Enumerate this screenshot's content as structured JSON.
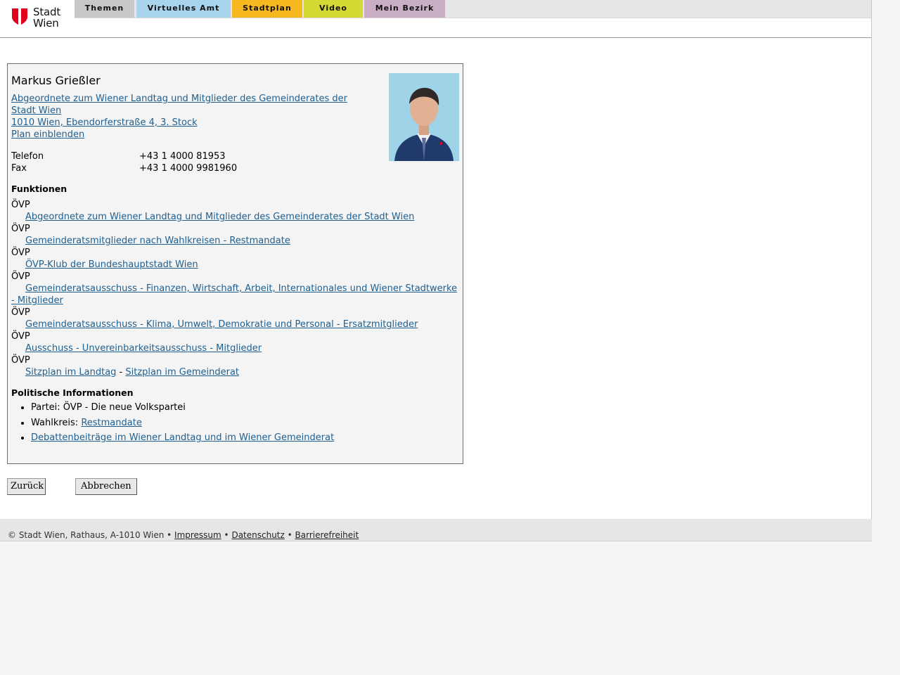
{
  "logo": {
    "line1": "Stadt",
    "line2": "Wien"
  },
  "nav": {
    "tabs": [
      {
        "label": "Themen",
        "color": "#c8c8c8"
      },
      {
        "label": "Virtuelles Amt",
        "color": "#a9d4ee"
      },
      {
        "label": "Stadtplan",
        "color": "#f6b71f"
      },
      {
        "label": "Video",
        "color": "#d6d834"
      },
      {
        "label": "Mein Bezirk",
        "color": "#c9aec5"
      }
    ]
  },
  "person": {
    "name": "Markus Grießler",
    "role_link": "Abgeordnete zum Wiener Landtag und Mitglieder des Gemeinderates der Stadt Wien ",
    "address_link": "1010 Wien, Ebendorferstraße 4, 3. Stock",
    "plan_link": "Plan einblenden",
    "contacts": [
      {
        "label": "Telefon",
        "value": "+43 1 4000 81953"
      },
      {
        "label": "Fax",
        "value": "+43 1 4000 9981960"
      }
    ]
  },
  "functions": {
    "heading": "Funktionen",
    "items": [
      {
        "party": "ÖVP",
        "link": "Abgeordnete zum Wiener Landtag und Mitglieder des Gemeinderates der Stadt Wien"
      },
      {
        "party": "ÖVP",
        "link": "Gemeinderatsmitglieder nach Wahlkreisen - Restmandate"
      },
      {
        "party": "ÖVP",
        "link": "ÖVP-Klub der Bundeshauptstadt Wien"
      },
      {
        "party": "ÖVP",
        "link": "Gemeinderatsausschuss - Finanzen, Wirtschaft, Arbeit, Internationales und Wiener Stadtwerke - Mitglieder"
      },
      {
        "party": "ÖVP",
        "link": "Gemeinderatsausschuss - Klima, Umwelt, Demokratie und Personal - Ersatzmitglieder"
      },
      {
        "party": "ÖVP",
        "link": "Ausschuss - Unvereinbarkeitsausschuss - Mitglieder"
      }
    ],
    "last_party": "ÖVP",
    "sitzplan_landtag": "Sitzplan im Landtag",
    "sitzplan_separator": " - ",
    "sitzplan_gemeinderat": "Sitzplan im Gemeinderat"
  },
  "political": {
    "heading": "Politische Informationen",
    "partei_label": "Partei: ",
    "partei_value": "ÖVP - Die neue Volkspartei",
    "wahlkreis_label": "Wahlkreis: ",
    "wahlkreis_link": "Restmandate",
    "debatten_link": "Debattenbeiträge im Wiener Landtag und im Wiener Gemeinderat"
  },
  "buttons": {
    "back": "Zurück",
    "cancel": "Abbrechen"
  },
  "footer": {
    "copyright": "© Stadt Wien, Rathaus, A-1010 Wien",
    "sep": " • ",
    "impressum": "Impressum",
    "datenschutz": "Datenschutz",
    "barrierefreiheit": "Barrierefreiheit"
  },
  "colors": {
    "link": "#1f5f8f",
    "logo_red": "#e2001a"
  }
}
